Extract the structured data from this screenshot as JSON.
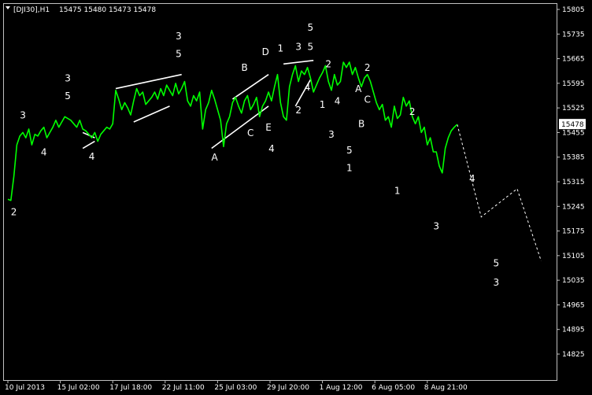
{
  "chart_data": {
    "type": "line",
    "title": "[DJI30],H1  15475 15480 15473 15478",
    "header_symbol": "[DJI30],H1",
    "header_ohlc": "15475 15480 15473 15478",
    "current_price_label": "15478",
    "current_price": 15478,
    "ylim": [
      14825,
      15805
    ],
    "y_ticks": [
      15805,
      15735,
      15665,
      15595,
      15525,
      15455,
      15385,
      15315,
      15245,
      15175,
      15105,
      15035,
      14965,
      14895,
      14825
    ],
    "x_ticks": [
      "10 Jul 2013",
      "15 Jul 02:00",
      "17 Jul 18:00",
      "22 Jul 11:00",
      "25 Jul 03:00",
      "29 Jul 20:00",
      "1 Aug 12:00",
      "6 Aug 05:00",
      "8 Aug 21:00"
    ],
    "x_range": [
      0,
      150
    ],
    "x_tick_positions": [
      0,
      17.5,
      35,
      52.5,
      70,
      87.5,
      105,
      122.5,
      140
    ],
    "grid": false,
    "colors": {
      "background": "#000000",
      "price": "#00ff00",
      "axis": "#c0c0c0",
      "label": "#ffffff",
      "annotation": "#ffffff"
    },
    "series": [
      {
        "x": [
          0,
          1,
          2,
          3,
          4,
          5,
          6,
          7,
          8,
          9,
          10,
          11,
          12,
          13,
          14,
          15,
          16,
          17,
          18,
          19,
          20,
          21,
          22,
          23,
          24,
          25,
          26,
          27,
          28,
          29,
          30,
          31,
          32,
          33,
          34,
          35,
          36,
          37,
          38,
          39,
          40,
          41,
          42,
          43,
          44,
          45,
          46,
          47,
          48,
          49,
          50,
          51,
          52,
          53,
          54,
          55,
          56,
          57,
          58,
          59,
          60,
          61,
          62,
          63,
          64,
          65,
          66,
          67,
          68,
          69,
          70,
          71,
          72,
          73,
          74,
          75,
          76,
          77,
          78,
          79,
          80,
          81,
          82,
          83,
          84,
          85,
          86,
          87,
          88,
          89,
          90,
          91,
          92,
          93,
          94,
          95,
          96,
          97,
          98,
          99,
          100,
          101,
          102,
          103,
          104,
          105,
          106,
          107,
          108,
          109,
          110,
          111,
          112,
          113,
          114,
          115,
          116,
          117,
          118,
          119,
          120,
          121,
          122,
          123,
          124,
          125,
          126,
          127,
          128,
          129,
          130,
          131,
          132,
          133,
          134,
          135,
          136,
          137,
          138,
          139,
          140,
          141,
          142,
          143,
          144,
          145,
          146,
          147,
          148,
          149,
          150
        ],
        "y": [
          15265,
          15262,
          15330,
          15420,
          15445,
          15455,
          15440,
          15465,
          15420,
          15450,
          15445,
          15460,
          15470,
          15440,
          15455,
          15470,
          15490,
          15470,
          15485,
          15500,
          15495,
          15490,
          15480,
          15470,
          15490,
          15465,
          15460,
          15450,
          15440,
          15455,
          15430,
          15450,
          15460,
          15470,
          15465,
          15480,
          15575,
          15550,
          15520,
          15540,
          15525,
          15505,
          15545,
          15580,
          15560,
          15570,
          15535,
          15545,
          15555,
          15570,
          15550,
          15580,
          15560,
          15590,
          15575,
          15560,
          15595,
          15565,
          15580,
          15600,
          15545,
          15530,
          15560,
          15545,
          15570,
          15465,
          15520,
          15540,
          15575,
          15550,
          15520,
          15490,
          15415,
          15480,
          15500,
          15540,
          15555,
          15530,
          15510,
          15545,
          15560,
          15520,
          15535,
          15555,
          15500,
          15530,
          15545,
          15570,
          15545,
          15585,
          15620,
          15540,
          15500,
          15490,
          15585,
          15620,
          15645,
          15600,
          15630,
          15620,
          15640,
          15610,
          15570,
          15590,
          15610,
          15625,
          15645,
          15600,
          15575,
          15620,
          15590,
          15600,
          15655,
          15640,
          15655,
          15620,
          15640,
          15610,
          15585,
          15610,
          15620,
          15600,
          15570,
          15540,
          15520,
          15535,
          15490,
          15500,
          15470,
          15530,
          15495,
          15505,
          15555,
          15530,
          15545,
          15500,
          15480,
          15500,
          15455,
          15470,
          15420,
          15440,
          15400,
          15400,
          15360,
          15340,
          15410,
          15440,
          15460,
          15470,
          15478
        ]
      }
    ],
    "projection": {
      "x": [
        150,
        158,
        170,
        178
      ],
      "y": [
        15478,
        15215,
        15295,
        15090
      ]
    },
    "annotations": [
      {
        "text": "2",
        "x": 2,
        "y": 15220
      },
      {
        "text": "3",
        "x": 5,
        "y": 15495
      },
      {
        "text": "4",
        "x": 12,
        "y": 15390
      },
      {
        "text": "3",
        "x": 20,
        "y": 15600
      },
      {
        "text": "5",
        "x": 20,
        "y": 15550
      },
      {
        "text": "4",
        "x": 28,
        "y": 15378
      },
      {
        "text": "3",
        "x": 57,
        "y": 15720
      },
      {
        "text": "5",
        "x": 57,
        "y": 15670
      },
      {
        "text": "A",
        "x": 69,
        "y": 15375
      },
      {
        "text": "B",
        "x": 79,
        "y": 15630
      },
      {
        "text": "C",
        "x": 81,
        "y": 15445
      },
      {
        "text": "D",
        "x": 86,
        "y": 15675
      },
      {
        "text": "E",
        "x": 87,
        "y": 15460
      },
      {
        "text": "4",
        "x": 88,
        "y": 15400
      },
      {
        "text": "1",
        "x": 91,
        "y": 15685
      },
      {
        "text": "3",
        "x": 97,
        "y": 15690
      },
      {
        "text": "5",
        "x": 101,
        "y": 15745
      },
      {
        "text": "5",
        "x": 101,
        "y": 15690
      },
      {
        "text": "4",
        "x": 100,
        "y": 15575
      },
      {
        "text": "2",
        "x": 97,
        "y": 15510
      },
      {
        "text": "1",
        "x": 105,
        "y": 15525
      },
      {
        "text": "2",
        "x": 107,
        "y": 15640
      },
      {
        "text": "4",
        "x": 110,
        "y": 15535
      },
      {
        "text": "3",
        "x": 108,
        "y": 15440
      },
      {
        "text": "5",
        "x": 114,
        "y": 15395
      },
      {
        "text": "1",
        "x": 114,
        "y": 15345
      },
      {
        "text": "2",
        "x": 120,
        "y": 15630
      },
      {
        "text": "A",
        "x": 117,
        "y": 15570
      },
      {
        "text": "C",
        "x": 120,
        "y": 15540
      },
      {
        "text": "B",
        "x": 118,
        "y": 15470
      },
      {
        "text": "2",
        "x": 135,
        "y": 15505
      },
      {
        "text": "1",
        "x": 130,
        "y": 15280
      },
      {
        "text": "3",
        "x": 143,
        "y": 15180
      },
      {
        "text": "4",
        "x": 155,
        "y": 15315
      },
      {
        "text": "5",
        "x": 163,
        "y": 15075
      },
      {
        "text": "3",
        "x": 163,
        "y": 15020
      }
    ],
    "trendlines": [
      [
        [
          36,
          15580
        ],
        [
          58,
          15620
        ]
      ],
      [
        [
          42,
          15485
        ],
        [
          54,
          15530
        ]
      ],
      [
        [
          25,
          15455
        ],
        [
          29,
          15440
        ]
      ],
      [
        [
          25,
          15410
        ],
        [
          29,
          15430
        ]
      ],
      [
        [
          75,
          15550
        ],
        [
          87,
          15620
        ]
      ],
      [
        [
          68,
          15410
        ],
        [
          87,
          15530
        ]
      ],
      [
        [
          92,
          15650
        ],
        [
          102,
          15660
        ]
      ],
      [
        [
          96,
          15530
        ],
        [
          101,
          15605
        ]
      ]
    ]
  }
}
